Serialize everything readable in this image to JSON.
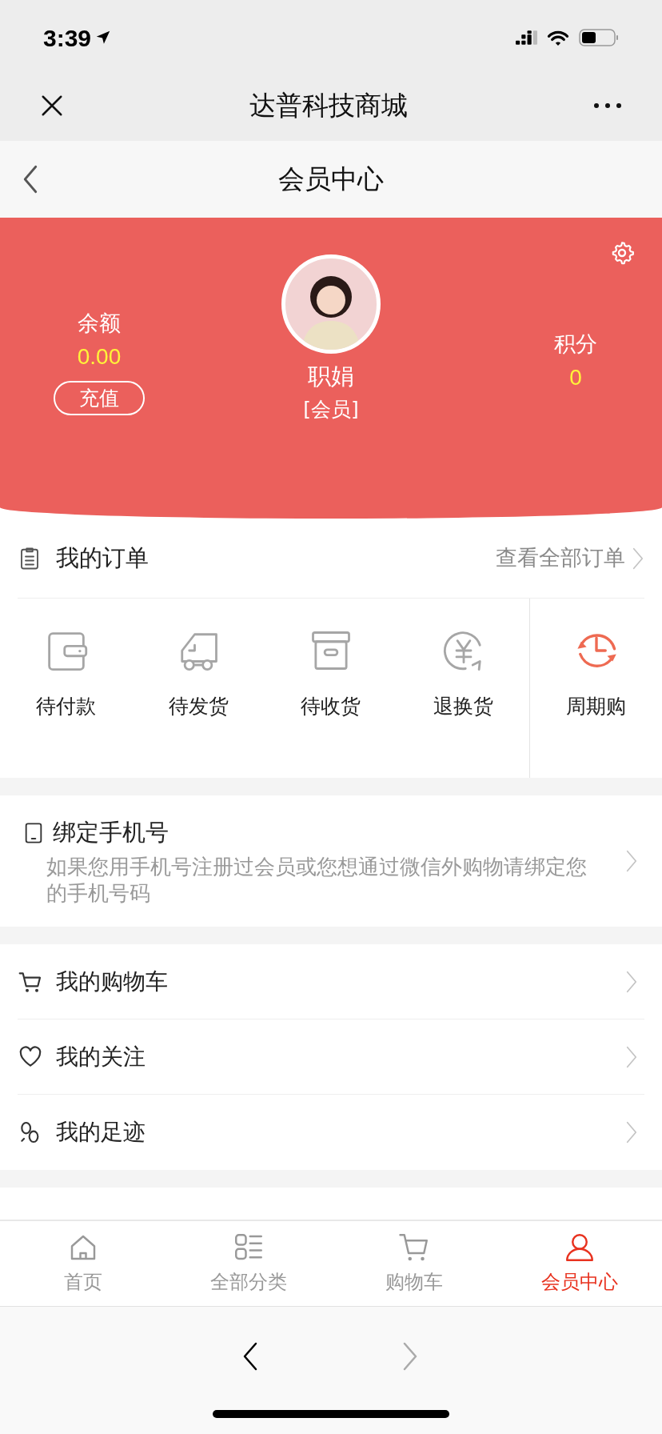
{
  "status_bar": {
    "time": "3:39"
  },
  "browser_nav": {
    "title": "达普科技商城"
  },
  "page_header": {
    "title": "会员中心"
  },
  "member": {
    "balance_label": "余额",
    "balance": "0.00",
    "recharge_button": "充值",
    "name": "职娟",
    "level": "[会员]",
    "points_label": "积分",
    "points": "0"
  },
  "orders": {
    "title": "我的订单",
    "view_all": "查看全部订单",
    "items": [
      {
        "label": "待付款",
        "kind": "status"
      },
      {
        "label": "待发货",
        "kind": "status"
      },
      {
        "label": "待收货",
        "kind": "status"
      },
      {
        "label": "退换货",
        "kind": "status"
      },
      {
        "label": "周期购",
        "kind": "subscription"
      }
    ]
  },
  "bind_phone": {
    "title": "绑定手机号",
    "description": "如果您用手机号注册过会员或您想通过微信外购物请绑定您的手机号码"
  },
  "menu": [
    {
      "label": "我的购物车"
    },
    {
      "label": "我的关注"
    },
    {
      "label": "我的足迹"
    }
  ],
  "tab_bar": [
    {
      "label": "首页",
      "selected": false
    },
    {
      "label": "全部分类",
      "selected": false
    },
    {
      "label": "购物车",
      "selected": false
    },
    {
      "label": "会员中心",
      "selected": true
    }
  ]
}
